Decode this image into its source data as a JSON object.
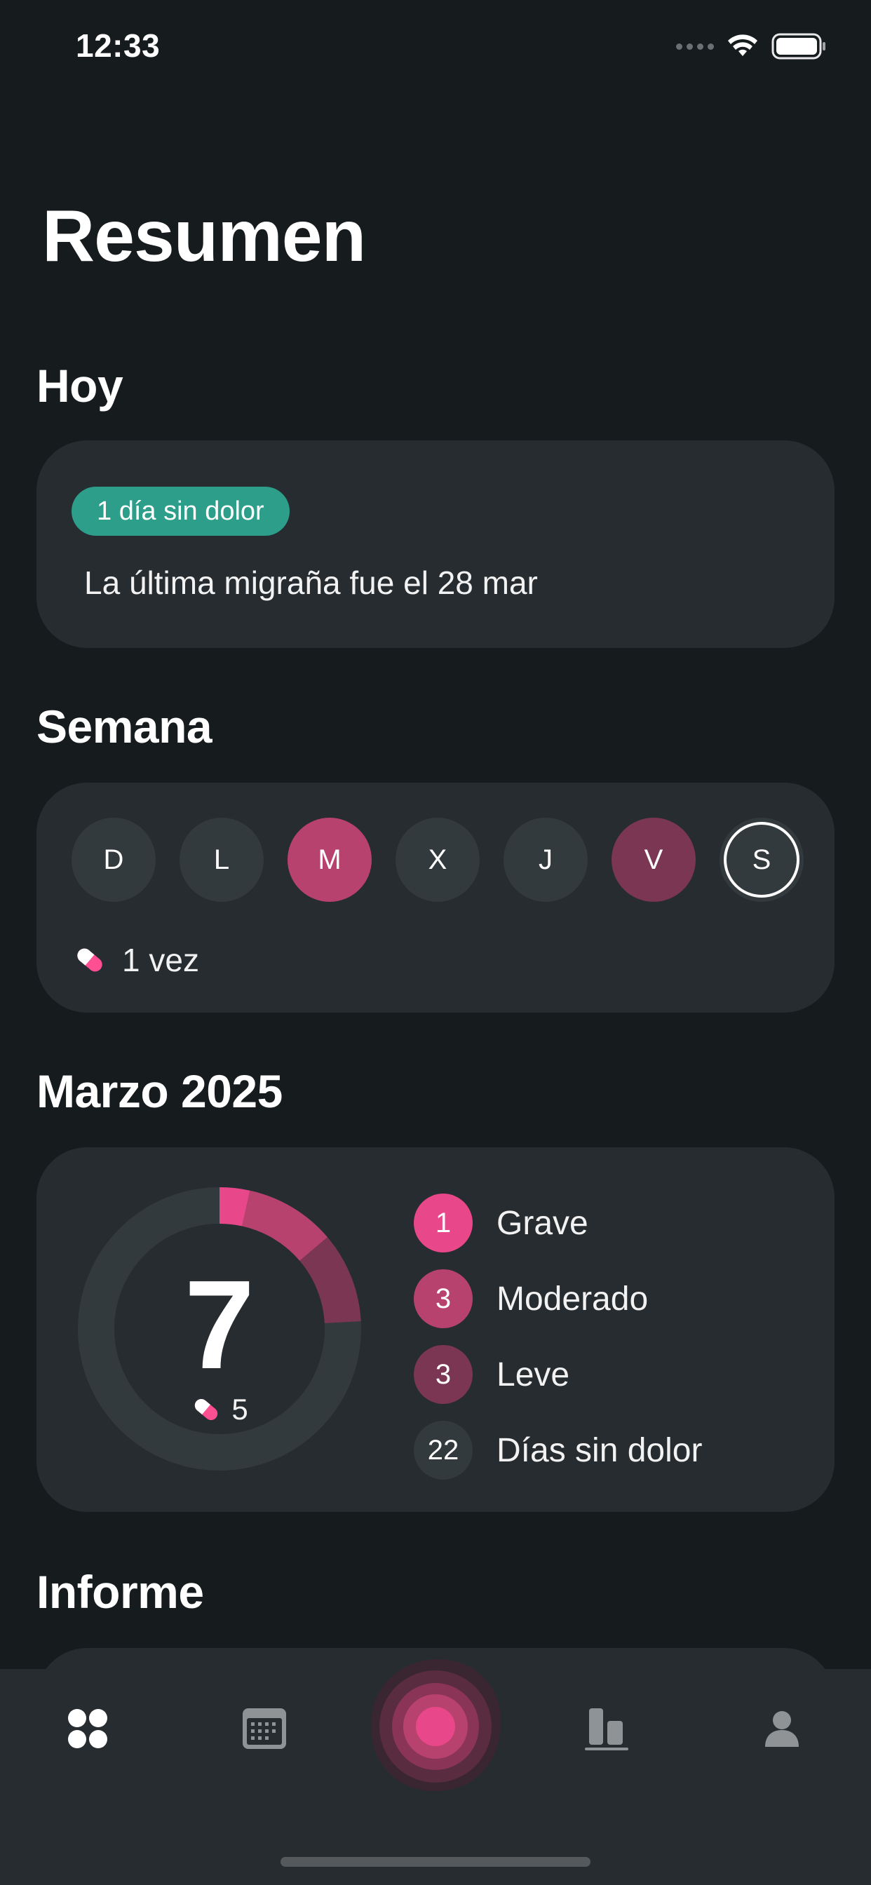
{
  "status_bar": {
    "time": "12:33"
  },
  "page_title": "Resumen",
  "today": {
    "title": "Hoy",
    "badge": "1 día sin dolor",
    "message": "La última migraña fue el 28 mar",
    "badge_color": "#2c9e8a"
  },
  "week": {
    "title": "Semana",
    "days": [
      {
        "label": "D",
        "state": "none"
      },
      {
        "label": "L",
        "state": "none"
      },
      {
        "label": "M",
        "state": "moderate"
      },
      {
        "label": "X",
        "state": "none"
      },
      {
        "label": "J",
        "state": "none"
      },
      {
        "label": "V",
        "state": "mild"
      },
      {
        "label": "S",
        "state": "today"
      }
    ],
    "medication": {
      "icon": "pill-icon",
      "count_text": "1 vez"
    }
  },
  "month": {
    "title": "Marzo 2025",
    "total": "7",
    "medication_count": "5",
    "legend": [
      {
        "count": "1",
        "label": "Grave",
        "color": "#e8478a"
      },
      {
        "count": "3",
        "label": "Moderado",
        "color": "#b8426e"
      },
      {
        "count": "3",
        "label": "Leve",
        "color": "#7a3652"
      },
      {
        "count": "22",
        "label": "Días sin dolor",
        "color": "#323a3e"
      }
    ]
  },
  "report": {
    "title": "Informe"
  },
  "tab_bar": {
    "items": [
      {
        "icon": "dashboard-icon",
        "active": true
      },
      {
        "icon": "calendar-icon",
        "active": false
      },
      {
        "icon": "record-migraine-icon",
        "active": false
      },
      {
        "icon": "stats-icon",
        "active": false
      },
      {
        "icon": "profile-icon",
        "active": false
      }
    ]
  },
  "colors": {
    "background": "#161b1e",
    "card": "#262c30",
    "severe": "#e8478a",
    "moderate": "#b8426e",
    "mild": "#7a3652",
    "pain_free": "#323a3e",
    "accent_teal": "#2c9e8a"
  }
}
